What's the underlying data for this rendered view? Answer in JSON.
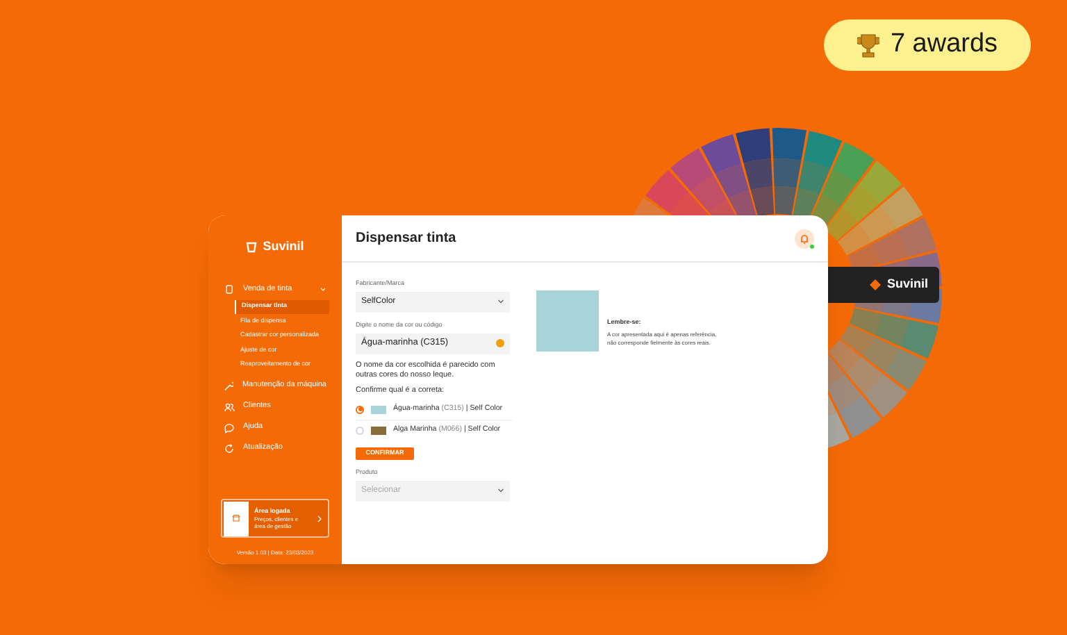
{
  "badge": {
    "text": "7 awards"
  },
  "fan_deck": {
    "brand": "Suvinil"
  },
  "sidebar": {
    "logo": "Suvinil",
    "menu": [
      {
        "label": "Venda de tinta",
        "expanded": true,
        "children": [
          {
            "label": "Dispensar tinta",
            "selected": true
          },
          {
            "label": "Fila de dispensa",
            "selected": false
          },
          {
            "label": "Cadastrar cor personalizada",
            "selected": false
          },
          {
            "label": "Ajuste de cor",
            "selected": false
          },
          {
            "label": "Reaproveitamento de cor",
            "selected": false
          }
        ]
      },
      {
        "label": "Manutenção da máquina"
      },
      {
        "label": "Clientes"
      },
      {
        "label": "Ajuda"
      },
      {
        "label": "Atualização"
      }
    ],
    "login_card": {
      "title": "Área logada",
      "text": "Preços, clientes e área de gestão"
    },
    "version": "Versão 1.03 | Data: 23/03/2023"
  },
  "main": {
    "title": "Dispensar tinta",
    "notifications": {
      "unread": true
    },
    "brand_field": {
      "label": "Fabricante/Marca",
      "value": "SelfColor"
    },
    "color_field": {
      "label": "Digite o nome da cor ou código",
      "value": "Água-marinha (C315)",
      "warning": true
    },
    "message": "O nome da cor escolhida é parecido com outras cores do nosso leque.",
    "question": "Confirme qual é a correta:",
    "options": [
      {
        "name": "Água-marinha",
        "code": "(C315)",
        "brand": "| Self Color",
        "color": "#a8d3d9",
        "selected": true
      },
      {
        "name": "Alga Marinha",
        "code": "(M066)",
        "brand": "| Self Color",
        "color": "#8a6d3b",
        "selected": false
      }
    ],
    "confirm_button": "CONFIRMAR",
    "product_field": {
      "label": "Produto",
      "placeholder": "Selecionar",
      "disabled": true
    },
    "preview": {
      "color": "#a8d3d9",
      "note_title": "Lembre-se:",
      "note_text": "A cor apresentada aqui é apenas referência, não corresponde fielmente às cores reais."
    }
  }
}
